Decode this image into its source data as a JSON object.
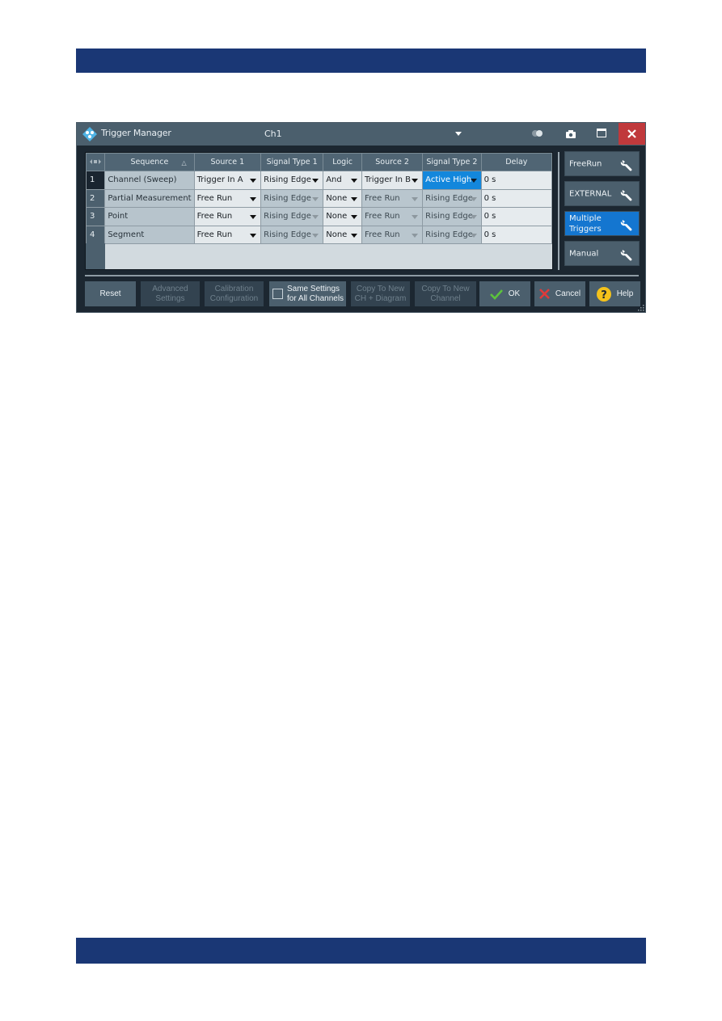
{
  "dialog": {
    "title": "Trigger Manager",
    "channel": "Ch1",
    "colors": {
      "band": "#1a3775",
      "titlebar": "#4b5f6d",
      "close": "#c0393c",
      "active_blue": "#1387dc",
      "selected_button": "#1476d0"
    }
  },
  "grid": {
    "columns": [
      "Sequence",
      "Source 1",
      "Signal Type 1",
      "Logic",
      "Source 2",
      "Signal Type 2",
      "Delay"
    ],
    "rows": [
      {
        "num": "1",
        "sequence": "Channel (Sweep)",
        "source1": "Trigger In A",
        "signal1": "Rising Edge",
        "logic": "And",
        "source2": "Trigger In B",
        "signal2": "Active High",
        "delay": "0 s"
      },
      {
        "num": "2",
        "sequence": "Partial Measurement",
        "source1": "Free Run",
        "signal1": "Rising Edge",
        "logic": "None",
        "source2": "Free Run",
        "signal2": "Rising Edge",
        "delay": "0 s"
      },
      {
        "num": "3",
        "sequence": "Point",
        "source1": "Free Run",
        "signal1": "Rising Edge",
        "logic": "None",
        "source2": "Free Run",
        "signal2": "Rising Edge",
        "delay": "0 s"
      },
      {
        "num": "4",
        "sequence": "Segment",
        "source1": "Free Run",
        "signal1": "Rising Edge",
        "logic": "None",
        "source2": "Free Run",
        "signal2": "Rising Edge",
        "delay": "0 s"
      }
    ]
  },
  "side_buttons": [
    {
      "label": "FreeRun",
      "active": false
    },
    {
      "label": "EXTERNAL",
      "active": false
    },
    {
      "label": "Multiple\nTriggers",
      "active": true
    },
    {
      "label": "Manual",
      "active": false
    }
  ],
  "footer": {
    "reset": "Reset",
    "advanced": "Advanced\nSettings",
    "calibration": "Calibration\nConfiguration",
    "same_settings": "Same Settings\nfor All Channels",
    "same_settings_checked": false,
    "copy_ch_diagram": "Copy To New\nCH + Diagram",
    "copy_channel": "Copy To New\nChannel",
    "ok": "OK",
    "cancel": "Cancel",
    "help": "Help"
  }
}
